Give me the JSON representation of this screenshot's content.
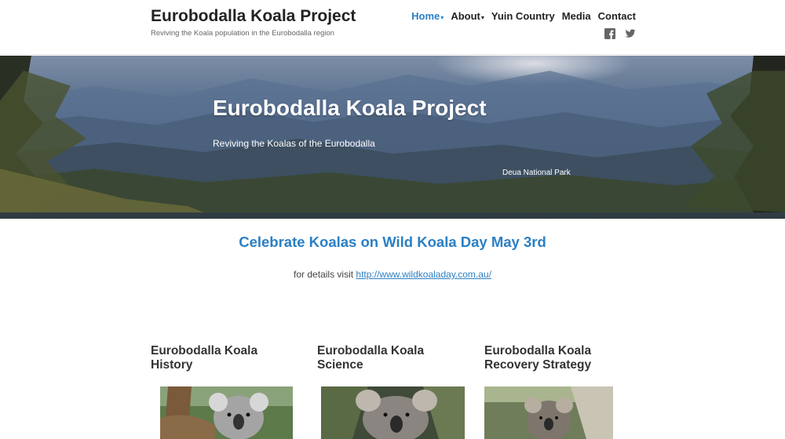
{
  "site": {
    "title": "Eurobodalla Koala Project",
    "tagline": "Reviving the Koala population in the Eurobodalla region"
  },
  "nav": {
    "items": [
      {
        "label": "Home",
        "has_dropdown": true,
        "active": true
      },
      {
        "label": "About",
        "has_dropdown": true,
        "active": false
      },
      {
        "label": "Yuin Country",
        "has_dropdown": false,
        "active": false
      },
      {
        "label": "Media",
        "has_dropdown": false,
        "active": false
      },
      {
        "label": "Contact",
        "has_dropdown": false,
        "active": false
      }
    ],
    "caret": "▾",
    "social": [
      "facebook-icon",
      "twitter-icon"
    ]
  },
  "hero": {
    "title": "Eurobodalla Koala Project",
    "subtitle": "Reviving the Koalas of the Eurobodalla",
    "caption": "Deua National Park"
  },
  "announcement": {
    "title": "Celebrate Koalas on Wild Koala Day May 3rd",
    "text_prefix": "for details visit ",
    "link": "http://www.wildkoaladay.com.au/"
  },
  "cards": [
    {
      "line1": "Eurobodalla Koala",
      "line2": "History"
    },
    {
      "line1": "Eurobodalla Koala",
      "line2": "Science"
    },
    {
      "line1": "Eurobodalla Koala",
      "line2": "Recovery Strategy"
    }
  ],
  "colors": {
    "accent": "#2c7fc4",
    "heading": "#222222"
  }
}
